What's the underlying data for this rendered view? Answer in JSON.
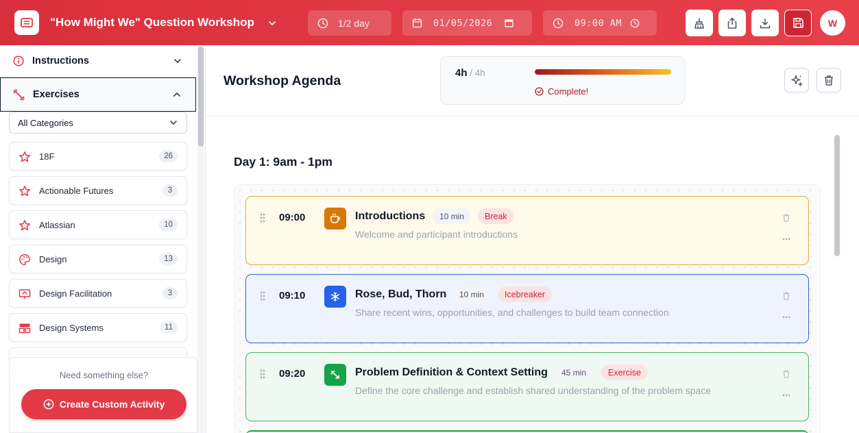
{
  "header": {
    "title": "\"How Might We\" Question Workshop",
    "duration": "1/2 day",
    "date": "01/05/2026",
    "time": "09:00 AM",
    "avatar_initial": "W"
  },
  "sidebar": {
    "instructions_label": "Instructions",
    "exercises_label": "Exercises",
    "category_select": "All Categories",
    "categories": [
      {
        "label": "18F",
        "count": "26",
        "icon": "star-icon"
      },
      {
        "label": "Actionable Futures",
        "count": "3",
        "icon": "star-icon"
      },
      {
        "label": "Atlassian",
        "count": "10",
        "icon": "star-icon"
      },
      {
        "label": "Design",
        "count": "13",
        "icon": "palette-icon"
      },
      {
        "label": "Design Facilitation",
        "count": "3",
        "icon": "presentation-icon"
      },
      {
        "label": "Design Systems",
        "count": "11",
        "icon": "layout-icon"
      }
    ],
    "footer_prompt": "Need something else?",
    "create_label": "Create Custom Activity"
  },
  "main": {
    "agenda_title": "Workshop Agenda",
    "progress": {
      "scheduled": "4h",
      "total": "4h",
      "fraction": 1.0,
      "status": "Complete!"
    },
    "day_title": "Day 1: 9am - 1pm",
    "activities": [
      {
        "time": "09:00",
        "title": "Introductions",
        "duration": "10 min",
        "tag": "Break",
        "description": "Welcome and participant introductions",
        "icon": "coffee-icon"
      },
      {
        "time": "09:10",
        "title": "Rose, Bud, Thorn",
        "duration": "10 min",
        "tag": "Icebreaker",
        "description": "Share recent wins, opportunities, and challenges to build team connection",
        "icon": "snowflake-icon"
      },
      {
        "time": "09:20",
        "title": "Problem Definition & Context Setting",
        "duration": "45 min",
        "tag": "Exercise",
        "description": "Define the core challenge and establish shared understanding of the problem space",
        "icon": "expand-icon"
      }
    ]
  },
  "colors": {
    "brand": "#e23a46",
    "break": "#d97706",
    "icebreaker": "#2563eb",
    "exercise": "#16a34a"
  }
}
